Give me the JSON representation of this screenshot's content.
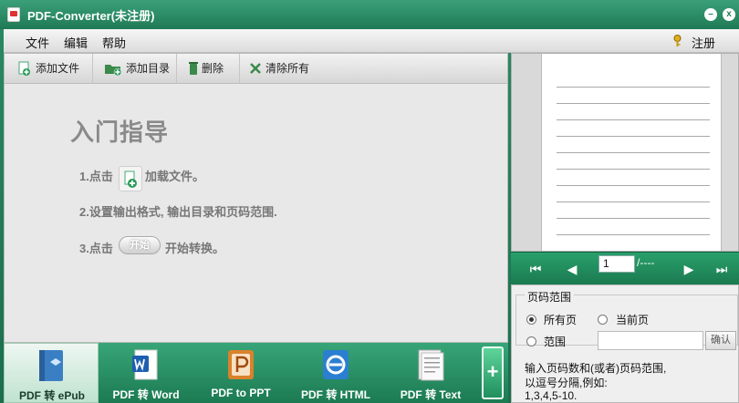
{
  "window": {
    "title": "PDF-Converter(未注册)",
    "minimize_glyph": "–",
    "close_glyph": "x"
  },
  "menu": {
    "file": "文件",
    "edit": "编辑",
    "help": "帮助",
    "register": "注册"
  },
  "toolbar": {
    "add_file": "添加文件",
    "add_dir": "添加目录",
    "delete": "删除",
    "clear_all": "清除所有"
  },
  "guide": {
    "title": "入门指导",
    "step1_prefix": "1.点击",
    "step1_suffix": "加载文件。",
    "step2": "2.设置输出格式, 输出目录和页码范围.",
    "step3_prefix": "3.点击",
    "step3_button": "开始",
    "step3_suffix": "开始转换。"
  },
  "preview": {
    "page_value": "1",
    "page_total": "/----",
    "first_glyph": "⏮",
    "prev_glyph": "◀",
    "next_glyph": "▶",
    "last_glyph": "⏭"
  },
  "range": {
    "legend": "页码范围",
    "all_pages": "所有页",
    "current_page": "当前页",
    "custom": "范围",
    "confirm": "确认",
    "help_line1": "输入页码数和(或者)页码范围,",
    "help_line2": "以逗号分隔,例如:",
    "help_line3": "1,3,4,5-10."
  },
  "conversions": {
    "epub": "PDF 转 ePub",
    "word": "PDF 转 Word",
    "ppt": "PDF to PPT",
    "html": "PDF 转 HTML",
    "text": "PDF 转 Text",
    "add_glyph": "+"
  },
  "colors": {
    "brand_green": "#1f7a55",
    "accent_green": "#2aa06b"
  }
}
